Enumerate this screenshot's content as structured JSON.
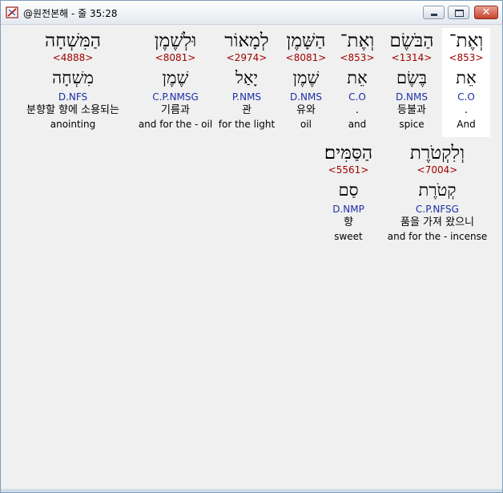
{
  "window": {
    "title": "@원전본해 - 줄 35:28",
    "minimize_icon": "minimize-icon",
    "maximize_icon": "maximize-icon",
    "close_glyph": "✕"
  },
  "words_row1": [
    {
      "hebrew": "וְאֶת־",
      "strong": "<853>",
      "lemma": "אֵת",
      "parse": "C.O",
      "korean": ".",
      "english": "And",
      "highlighted": true
    },
    {
      "hebrew": "הַבֹּשֶׂם",
      "strong": "<1314>",
      "lemma": "בֶּשֶׂם",
      "parse": "D.NMS",
      "korean": "등불과",
      "english": "spice"
    },
    {
      "hebrew": "וְאֶת־",
      "strong": "<853>",
      "lemma": "אֵת",
      "parse": "C.O",
      "korean": ".",
      "english": "and"
    },
    {
      "hebrew": "הַשָּׁמֶן",
      "strong": "<8081>",
      "lemma": "שֶׁמֶן",
      "parse": "D.NMS",
      "korean": "유와",
      "english": "oil"
    },
    {
      "hebrew": "לְמָאוֹר",
      "strong": "<2974>",
      "lemma": "יָאַל",
      "parse": "P.NMS",
      "korean": "관",
      "english": "for the light"
    },
    {
      "hebrew": "וּלְשֶׁמֶן",
      "strong": "<8081>",
      "lemma": "שֶׁמֶן",
      "parse": "C.P.NMSG",
      "korean": "기름과",
      "english": "and for the - oil"
    },
    {
      "hebrew": "הַמִּשְׁחָה",
      "strong": "<4888>",
      "lemma": "מִשְׁחָה",
      "parse": "D.NFS",
      "korean": "분향할 향에 소용되는",
      "english": "anointing"
    }
  ],
  "words_row2": [
    {
      "hebrew": "וְלִקְטֹרֶת",
      "strong": "<7004>",
      "lemma": "קְטֹרֶת",
      "parse": "C.P.NFSG",
      "korean": "품을 가져 왔으니",
      "english": "and for the - incense"
    },
    {
      "hebrew": "הַסַּמִּים׃",
      "strong": "<5561>",
      "lemma": "סַם",
      "parse": "D.NMP",
      "korean": "향",
      "english": "sweet"
    }
  ]
}
